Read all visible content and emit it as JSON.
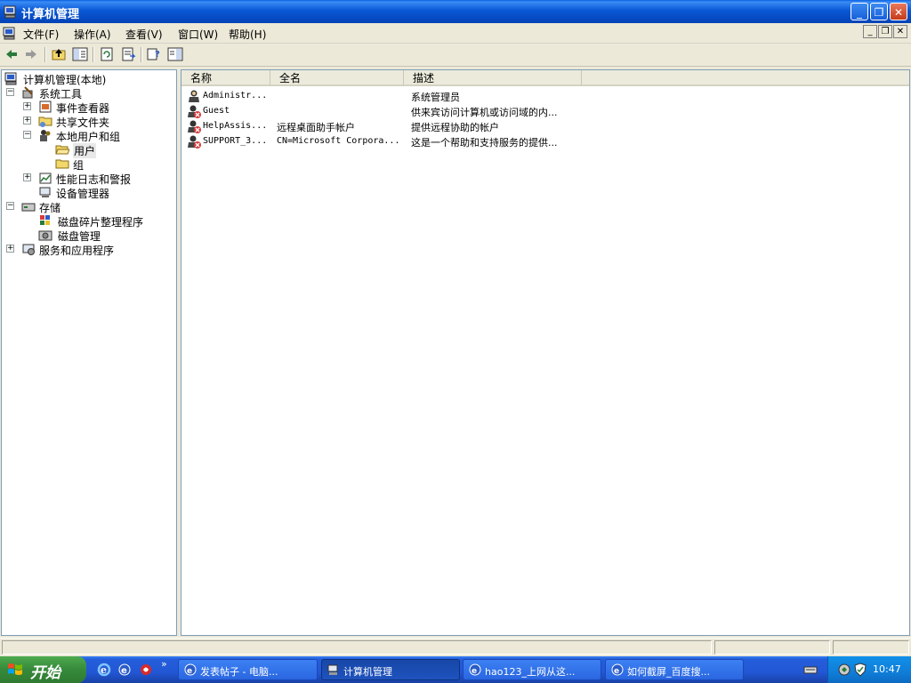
{
  "window": {
    "title": "计算机管理"
  },
  "menu": {
    "items": [
      "文件(F)",
      "操作(A)",
      "查看(V)",
      "窗口(W)",
      "帮助(H)"
    ]
  },
  "tree": {
    "root": "计算机管理(本地)",
    "system_tools": "系统工具",
    "event_viewer": "事件查看器",
    "shared_folders": "共享文件夹",
    "local_users_groups": "本地用户和组",
    "users": "用户",
    "groups": "组",
    "perf_logs": "性能日志和警报",
    "device_manager": "设备管理器",
    "storage": "存储",
    "defrag": "磁盘碎片整理程序",
    "disk_mgmt": "磁盘管理",
    "services_apps": "服务和应用程序"
  },
  "list": {
    "columns": [
      "名称",
      "全名",
      "描述"
    ],
    "rows": [
      {
        "name": "Administr...",
        "full": "",
        "desc": "系统管理员"
      },
      {
        "name": "Guest",
        "full": "",
        "desc": "供来宾访问计算机或访问域的内..."
      },
      {
        "name": "HelpAssis...",
        "full": "远程桌面助手帐户",
        "desc": "提供远程协助的帐户"
      },
      {
        "name": "SUPPORT_3...",
        "full": "CN=Microsoft Corpora...",
        "desc": "这是一个帮助和支持服务的提供..."
      }
    ]
  },
  "taskbar": {
    "start_label": "开始",
    "chevron": "»",
    "tasks": [
      "发表帖子 - 电脑...",
      "计算机管理",
      "hao123_上网从这...",
      "如何截屏_百度搜..."
    ],
    "clock": "10:47"
  },
  "colors": {
    "titlebar": "#0a58d6",
    "taskbar": "#245edb",
    "start": "#36893b",
    "tray": "#0f7ed9"
  }
}
